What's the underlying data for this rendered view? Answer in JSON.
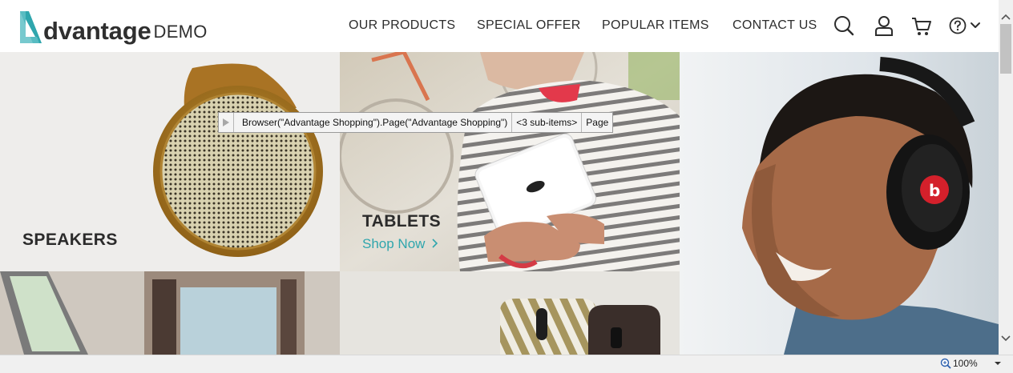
{
  "header": {
    "logo_word": "dvantage",
    "logo_demo": "DEMO",
    "nav": [
      {
        "label": "OUR PRODUCTS"
      },
      {
        "label": "SPECIAL OFFER"
      },
      {
        "label": "POPULAR ITEMS"
      },
      {
        "label": "CONTACT US"
      }
    ],
    "icons": [
      "search-icon",
      "user-icon",
      "cart-icon",
      "help-icon",
      "chevron-down-icon"
    ]
  },
  "tiles": {
    "speakers": {
      "title": "SPEAKERS"
    },
    "tablets": {
      "title": "TABLETS",
      "link": "Shop Now"
    }
  },
  "tooltip": {
    "path": "Browser(\"Advantage Shopping\").Page(\"Advantage Shopping\")",
    "sub_items": "<3 sub-items>",
    "type": "Page"
  },
  "statusbar": {
    "zoom": "100%"
  },
  "colors": {
    "accent": "#2fa6ad",
    "text": "#2d2d2d"
  }
}
